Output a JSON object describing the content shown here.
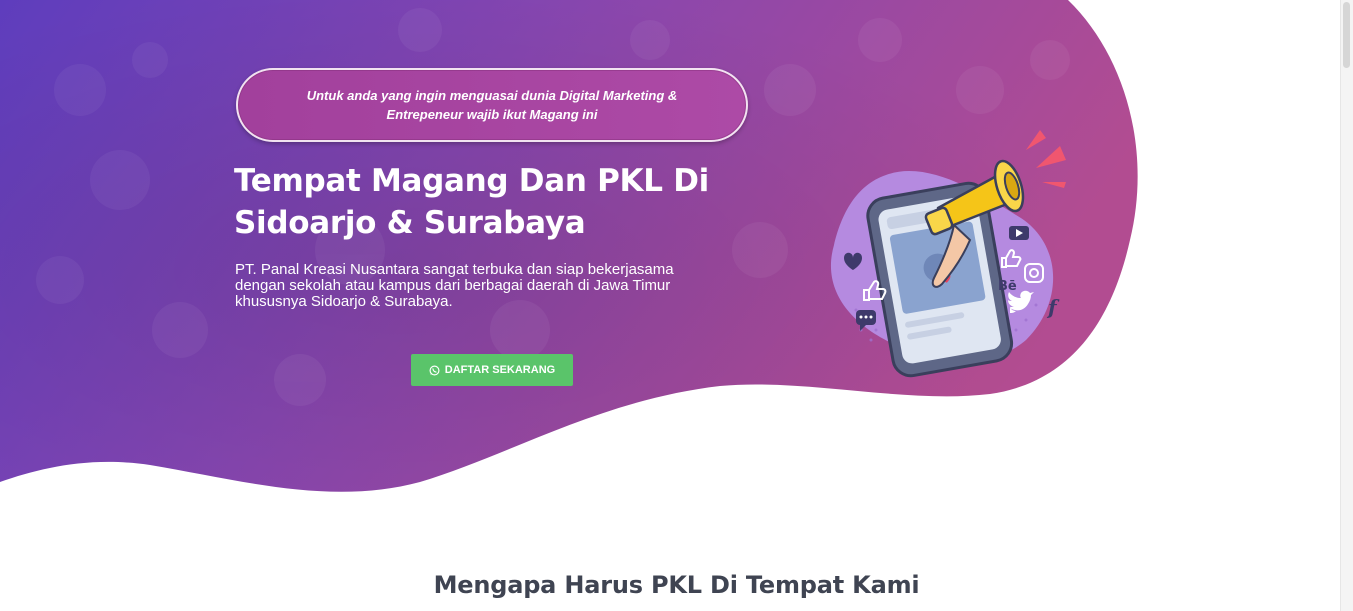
{
  "hero": {
    "tagline": "Untuk anda yang ingin menguasai dunia Digital Marketing & Entrepeneur wajib ikut Magang ini",
    "title": "Tempat Magang Dan PKL Di Sidoarjo & Surabaya",
    "description": "PT. Panal Kreasi Nusantara sangat terbuka dan siap bekerjasama dengan sekolah atau kampus dari berbagai daerah di Jawa Timur khususnya Sidoarjo & Surabaya.",
    "cta": {
      "label": "DAFTAR SEKARANG",
      "icon": "whatsapp-icon",
      "color": "#5ac46a"
    },
    "illustration": {
      "icons": [
        "megaphone-icon",
        "heart-icon",
        "like-icon",
        "chat-icon",
        "youtube-icon",
        "instagram-icon",
        "behance-icon",
        "twitter-icon",
        "facebook-icon"
      ],
      "behance_text": "Bē",
      "facebook_text": "f"
    },
    "colors": {
      "gradient_start": "#6a3fbc",
      "gradient_end": "#b14b96",
      "pill": "#a2409c"
    }
  },
  "section": {
    "title": "Mengapa Harus PKL Di Tempat Kami"
  }
}
